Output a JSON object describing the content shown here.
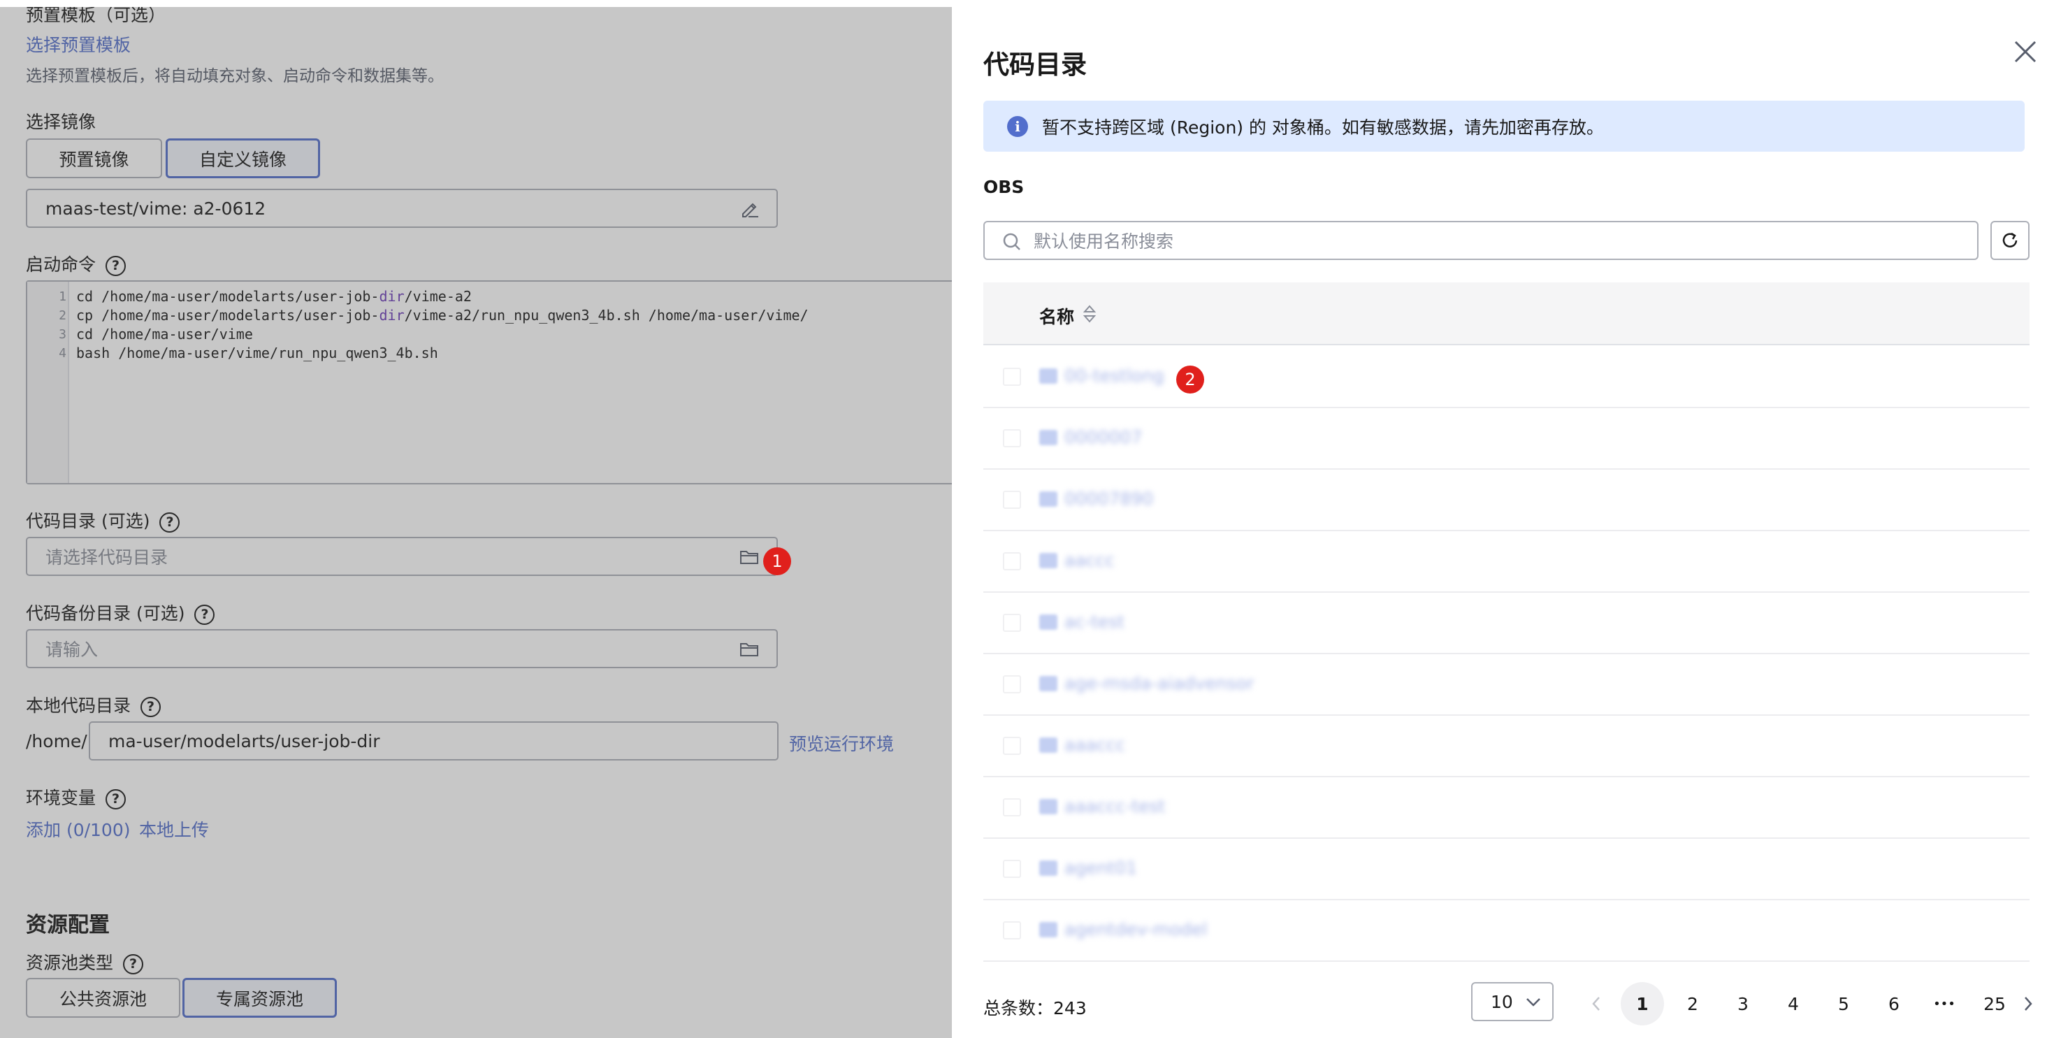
{
  "form": {
    "template_label": "预置模板（可选）",
    "template_link": "选择预置模板",
    "template_hint": "选择预置模板后，将自动填充对象、启动命令和数据集等。",
    "image_label": "选择镜像",
    "image_btn_preset": "预置镜像",
    "image_btn_custom": "自定义镜像",
    "image_value": "maas-test/vime: a2-0612",
    "cmd_label": "启动命令",
    "code_lines": [
      {
        "num": "1",
        "pre": "cd /home/ma-user/modelarts/user-job-",
        "dir": "dir",
        "post": "/vime-a2"
      },
      {
        "num": "2",
        "pre": "cp /home/ma-user/modelarts/user-job-",
        "dir": "dir",
        "post": "/vime-a2/run_npu_qwen3_4b.sh /home/ma-user/vime/"
      },
      {
        "num": "3",
        "pre": "cd /home/ma-user/vime",
        "dir": "",
        "post": ""
      },
      {
        "num": "4",
        "pre": "bash /home/ma-user/vime/run_npu_qwen3_4b.sh",
        "dir": "",
        "post": ""
      }
    ],
    "code_dir_label": "代码目录 (可选)",
    "code_dir_placeholder": "请选择代码目录",
    "backup_dir_label": "代码备份目录 (可选)",
    "backup_dir_placeholder": "请输入",
    "local_dir_label": "本地代码目录",
    "local_dir_prefix": "/home/",
    "local_dir_value": "ma-user/modelarts/user-job-dir",
    "preview_env_link": "预览运行环境",
    "env_label": "环境变量",
    "env_add_link": "添加 (0/100)",
    "env_upload_link": "本地上传",
    "resource_title": "资源配置",
    "pool_type_label": "资源池类型",
    "pool_public": "公共资源池",
    "pool_dedicated": "专属资源池",
    "badge1": "1",
    "badge2": "2"
  },
  "drawer": {
    "title": "代码目录",
    "notice": "暂不支持跨区域 (Region) 的 对象桶。如有敏感数据，请先加密再存放。",
    "info_icon": "i",
    "obs_label": "OBS",
    "search_placeholder": "默认使用名称搜索",
    "column_name": "名称",
    "rows": [
      {
        "name": "00-testlong"
      },
      {
        "name": "0000007"
      },
      {
        "name": "00007890"
      },
      {
        "name": "aaccc"
      },
      {
        "name": "ac-test"
      },
      {
        "name": "age-msda-aiadvensor"
      },
      {
        "name": "aaaccc"
      },
      {
        "name": "aaaccc-test"
      },
      {
        "name": "agent01"
      },
      {
        "name": "agentdev-model"
      }
    ],
    "total_label": "总条数：",
    "total_value": "243",
    "page_size": "10",
    "pages": [
      "1",
      "2",
      "3",
      "4",
      "5",
      "6"
    ],
    "ellipsis": "•••",
    "last_page": "25",
    "current_page": 1
  },
  "colors": {
    "accent": "#526ecc",
    "notice_bg": "#deeaff",
    "badge": "#e0201c"
  }
}
